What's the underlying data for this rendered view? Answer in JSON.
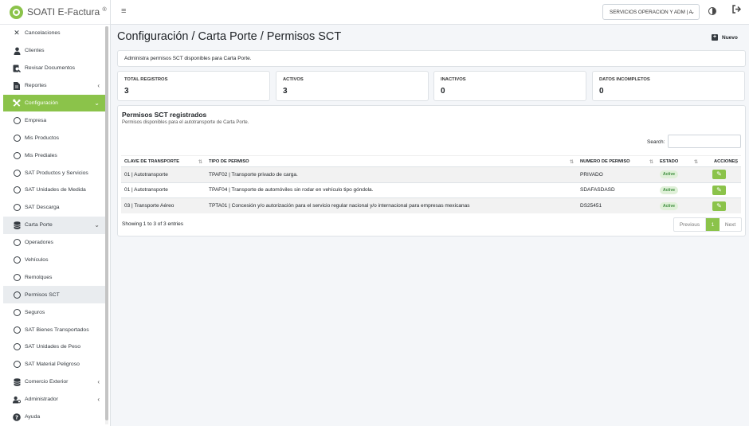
{
  "brand": {
    "name": "SOATI E-Factura",
    "mark": "®"
  },
  "sidebar": {
    "items": [
      {
        "label": "Cancelaciones",
        "icon": "close-icon"
      },
      {
        "label": "Clientes",
        "icon": "user-icon"
      },
      {
        "label": "Revisar Documentos",
        "icon": "search-doc-icon"
      },
      {
        "label": "Reportes",
        "icon": "file-icon"
      },
      {
        "label": "Configuración",
        "icon": "tools-icon"
      },
      {
        "label": "Empresa"
      },
      {
        "label": "Mis Productos"
      },
      {
        "label": "Mis Prediales"
      },
      {
        "label": "SAT Productos y Servicios"
      },
      {
        "label": "SAT Unidades de Medida"
      },
      {
        "label": "SAT Descarga"
      },
      {
        "label": "Carta Porte",
        "icon": "database-icon"
      },
      {
        "label": "Operadores"
      },
      {
        "label": "Vehículos"
      },
      {
        "label": "Remolques"
      },
      {
        "label": "Permisos SCT"
      },
      {
        "label": "Seguros"
      },
      {
        "label": "SAT Bienes Transportados"
      },
      {
        "label": "SAT Unidades de Peso"
      },
      {
        "label": "SAT Material Peligroso"
      },
      {
        "label": "Comercio Exterior",
        "icon": "database-icon"
      },
      {
        "label": "Administrador",
        "icon": "users-gear-icon"
      },
      {
        "label": "Ayuda",
        "icon": "question-icon"
      }
    ]
  },
  "topbar": {
    "company": "SERVICIOS OPERACION Y ADM | A"
  },
  "page": {
    "title": "Configuración / Carta Porte / Permisos SCT",
    "new_label": "Nuevo",
    "info": "Administra permisos SCT disponibles para Carta Porte."
  },
  "stats": [
    {
      "label": "TOTAL REGISTROS",
      "value": "3"
    },
    {
      "label": "ACTIVOS",
      "value": "3"
    },
    {
      "label": "INACTIVOS",
      "value": "0"
    },
    {
      "label": "DATOS INCOMPLETOS",
      "value": "0"
    }
  ],
  "table": {
    "title": "Permisos SCT registrados",
    "subtitle": "Permisos disponibles para el autotransporte de Carta Porte.",
    "search_label": "Search:",
    "columns": [
      "CLAVE DE TRANSPORTE",
      "TIPO DE PERMISO",
      "NUMERO DE PERMISO",
      "ESTADO",
      "ACCIONES"
    ],
    "rows": [
      {
        "clave": "01 | Autotransporte",
        "tipo": "TPAF02 | Transporte privado de carga.",
        "numero": "PRIVADO",
        "estado": "Active"
      },
      {
        "clave": "01 | Autotransporte",
        "tipo": "TPAF04 | Transporte de automóviles sin rodar en vehículo tipo góndola.",
        "numero": "SDAFASDASD",
        "estado": "Active"
      },
      {
        "clave": "03 | Transporte Aéreo",
        "tipo": "TPTA01 | Concesión y/o autorización para el servicio regular nacional y/o internacional para empresas mexicanas",
        "numero": "DS25451",
        "estado": "Active"
      }
    ],
    "showing": "Showing 1 to 3 of 3 entries",
    "pagination": {
      "prev": "Previous",
      "page": "1",
      "next": "Next"
    }
  },
  "colors": {
    "accent": "#8bc34a"
  }
}
